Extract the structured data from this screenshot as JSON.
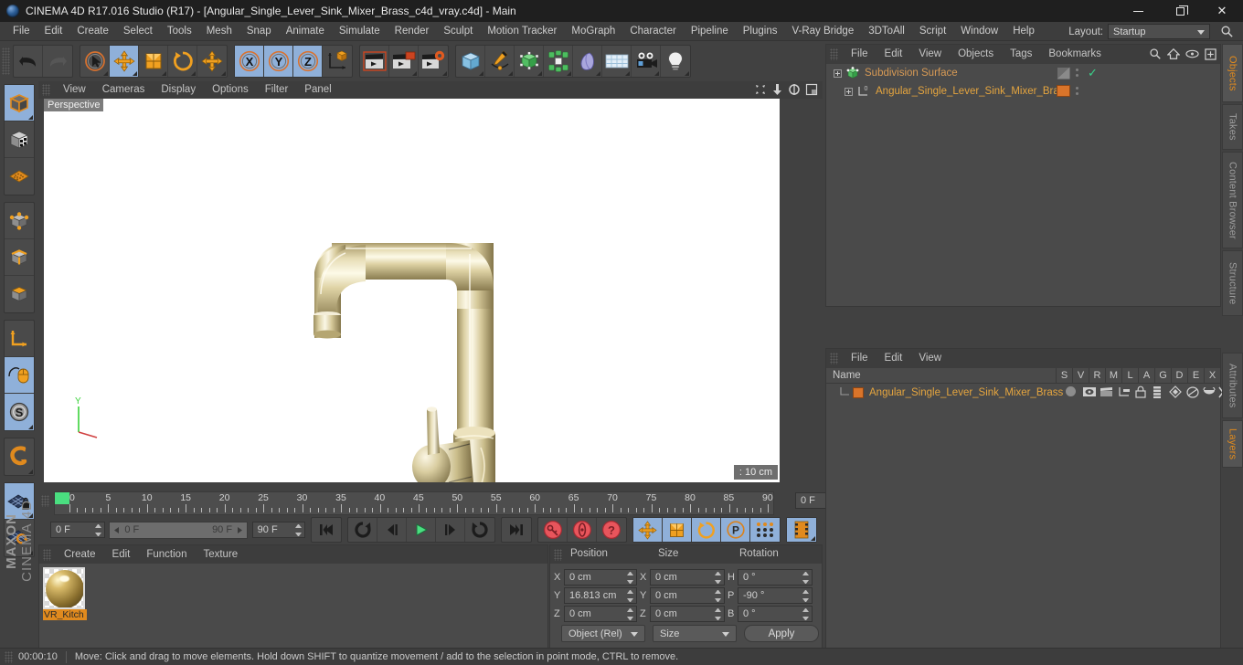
{
  "window": {
    "title": "CINEMA 4D R17.016 Studio (R17) - [Angular_Single_Lever_Sink_Mixer_Brass_c4d_vray.c4d] - Main",
    "minimize": "minimize-icon",
    "maximize": "maximize-icon",
    "close": "close-icon"
  },
  "menubar": {
    "items": [
      "File",
      "Edit",
      "Create",
      "Select",
      "Tools",
      "Mesh",
      "Snap",
      "Animate",
      "Simulate",
      "Render",
      "Sculpt",
      "Motion Tracker",
      "MoGraph",
      "Character",
      "Pipeline",
      "Plugins",
      "V-Ray Bridge",
      "3DToAll",
      "Script",
      "Window",
      "Help"
    ],
    "layout_label": "Layout:",
    "layout_value": "Startup"
  },
  "toolbar": {
    "groups": [
      {
        "name": "history",
        "buttons": [
          {
            "name": "undo-button",
            "icon": "undo-arrow-icon",
            "state": "normal"
          },
          {
            "name": "redo-button",
            "icon": "redo-arrow-icon",
            "state": "disabled"
          }
        ]
      },
      {
        "name": "transform-tools",
        "buttons": [
          {
            "name": "live-selection-tool",
            "icon": "cursor-circle-icon",
            "state": "normal"
          },
          {
            "name": "move-tool",
            "icon": "move-arrows-icon",
            "state": "active"
          },
          {
            "name": "scale-tool",
            "icon": "scale-box-icon",
            "state": "normal"
          },
          {
            "name": "rotate-tool",
            "icon": "rotate-arrow-icon",
            "state": "normal"
          },
          {
            "name": "drag-tool",
            "icon": "move-arrows-icon",
            "state": "normal"
          }
        ]
      },
      {
        "name": "axis-locks",
        "buttons": [
          {
            "name": "x-axis-lock",
            "icon": "x-axis-icon",
            "state": "active"
          },
          {
            "name": "y-axis-lock",
            "icon": "y-axis-icon",
            "state": "active"
          },
          {
            "name": "z-axis-lock",
            "icon": "z-axis-icon",
            "state": "active"
          },
          {
            "name": "world-object-coordinates",
            "icon": "axis-cube-icon",
            "state": "normal"
          }
        ]
      },
      {
        "name": "render-tools",
        "buttons": [
          {
            "name": "render-view-button",
            "icon": "render-clapper-icon",
            "state": "normal"
          },
          {
            "name": "render-to-picture-viewer-button",
            "icon": "render-picture-icon",
            "state": "normal"
          },
          {
            "name": "render-settings-button",
            "icon": "render-gear-icon",
            "state": "normal"
          }
        ]
      },
      {
        "name": "create-objects",
        "buttons": [
          {
            "name": "add-cube-button",
            "icon": "blue-cube-icon",
            "state": "normal"
          },
          {
            "name": "add-spline-button",
            "icon": "pen-spline-icon",
            "state": "normal"
          },
          {
            "name": "add-generator-button",
            "icon": "green-cube-icon",
            "state": "normal"
          },
          {
            "name": "add-deformer-button",
            "icon": "green-explode-icon",
            "state": "normal"
          },
          {
            "name": "add-scene-button",
            "icon": "purple-shape-icon",
            "state": "normal"
          },
          {
            "name": "add-environment-button",
            "icon": "floor-grid-icon",
            "state": "normal"
          },
          {
            "name": "add-camera-button",
            "icon": "camera-icon",
            "state": "normal"
          },
          {
            "name": "add-light-button",
            "icon": "light-bulb-icon",
            "state": "normal"
          }
        ]
      }
    ]
  },
  "left_toolbar": {
    "groups": [
      {
        "buttons": [
          {
            "name": "make-editable-button",
            "icon": "editable-cube-icon",
            "state": "active"
          },
          {
            "name": "model-mode-button",
            "icon": "texture-cube-icon",
            "state": "normal"
          },
          {
            "name": "texture-mode-button",
            "icon": "texture-grid-icon",
            "state": "normal"
          }
        ]
      },
      {
        "buttons": [
          {
            "name": "points-mode-button",
            "icon": "points-cube-icon",
            "state": "normal"
          },
          {
            "name": "edges-mode-button",
            "icon": "edges-cube-icon",
            "state": "normal"
          },
          {
            "name": "polygons-mode-button",
            "icon": "polygon-cube-icon",
            "state": "normal"
          }
        ]
      },
      {
        "buttons": [
          {
            "name": "object-axis-button",
            "icon": "axis-arrows-icon",
            "state": "normal"
          },
          {
            "name": "viewport-interaction-button",
            "icon": "mouse-icon",
            "state": "active"
          },
          {
            "name": "soft-selection-button",
            "icon": "s-circle-icon",
            "state": "active"
          }
        ]
      },
      {
        "buttons": [
          {
            "name": "magnet-tool-button",
            "icon": "magnet-icon",
            "state": "normal"
          }
        ]
      },
      {
        "buttons": [
          {
            "name": "lock-workplane-button",
            "icon": "grid-lock-icon",
            "state": "active"
          },
          {
            "name": "workplane-rotate-button",
            "icon": "grid-rotate-icon",
            "state": "normal"
          }
        ]
      }
    ],
    "brand_line1": "MAXON",
    "brand_line2": "CINEMA 4D"
  },
  "viewport": {
    "menu": [
      "View",
      "Cameras",
      "Display",
      "Options",
      "Filter",
      "Panel"
    ],
    "label": "Perspective",
    "scale": ": 10 cm",
    "axis_label": "Y",
    "corner_icons": [
      "pan-icon",
      "zoom-icon",
      "rotate-icon",
      "maximize-view-icon"
    ]
  },
  "timeline": {
    "ticks": [
      "0",
      "5",
      "10",
      "15",
      "20",
      "25",
      "30",
      "35",
      "40",
      "45",
      "50",
      "55",
      "60",
      "65",
      "70",
      "75",
      "80",
      "85",
      "90"
    ],
    "current_frame_right": "0 F",
    "current_frame_left": "0 F",
    "preview_start": "0 F",
    "preview_end": "90 F",
    "project_end": "90 F",
    "transport": [
      {
        "name": "go-to-start-button",
        "icon": "skip-start-icon"
      },
      {
        "name": "play-backwards-loop-button",
        "icon": "loop-back-icon"
      },
      {
        "name": "previous-frame-button",
        "icon": "step-back-icon"
      },
      {
        "name": "play-button",
        "icon": "play-icon"
      },
      {
        "name": "next-frame-button",
        "icon": "step-forward-icon"
      },
      {
        "name": "play-forwards-loop-button",
        "icon": "loop-forward-icon"
      },
      {
        "name": "go-to-end-button",
        "icon": "skip-end-icon"
      }
    ],
    "keyframe_tools": [
      {
        "name": "record-active-objects-button",
        "icon": "red-key-icon"
      },
      {
        "name": "autokeying-button",
        "icon": "red-autokey-icon"
      },
      {
        "name": "keyframe-selection-button",
        "icon": "red-question-icon"
      }
    ],
    "key_axis": [
      {
        "name": "key-position-button",
        "icon": "move-arrows-icon",
        "state": "active"
      },
      {
        "name": "key-scale-button",
        "icon": "scale-box-icon",
        "state": "active"
      },
      {
        "name": "key-rotation-button",
        "icon": "rotate-arrow-icon",
        "state": "active"
      },
      {
        "name": "key-parameter-button",
        "icon": "p-circle-icon",
        "state": "active"
      },
      {
        "name": "point-level-animation-button",
        "icon": "dots-grid-icon",
        "state": "active"
      }
    ],
    "extra_button": {
      "name": "timeline-strip-button",
      "icon": "film-strip-icon",
      "state": "active"
    }
  },
  "material_manager": {
    "menu": [
      "Create",
      "Edit",
      "Function",
      "Texture"
    ],
    "materials": [
      {
        "name": "VR_Kitch",
        "icon": "brass-material-sphere"
      }
    ]
  },
  "coordinates": {
    "columns": [
      "Position",
      "Size",
      "Rotation"
    ],
    "position": {
      "labels": [
        "X",
        "Y",
        "Z"
      ],
      "values": [
        "0 cm",
        "16.813 cm",
        "0 cm"
      ]
    },
    "size": {
      "labels": [
        "X",
        "Y",
        "Z"
      ],
      "values": [
        "0 cm",
        "0 cm",
        "0 cm"
      ]
    },
    "rotation": {
      "labels": [
        "H",
        "P",
        "B"
      ],
      "values": [
        "0 °",
        "-90 °",
        "0 °"
      ]
    },
    "mode_dropdown": "Object (Rel)",
    "size_dropdown": "Size",
    "apply_button": "Apply"
  },
  "object_manager": {
    "menu": [
      "File",
      "Edit",
      "View",
      "Objects",
      "Tags",
      "Bookmarks"
    ],
    "header_icons": [
      "search-icon",
      "home-icon",
      "eye-icon",
      "new-layer-icon"
    ],
    "rows": [
      {
        "name": "Subdivision Surface",
        "indent": 0,
        "color": "#d79a55",
        "tag_icon": "halfgrey-tag",
        "check": "✓"
      },
      {
        "name": "Angular_Single_Lever_Sink_Mixer_Brass",
        "indent": 1,
        "color": "#e5a53f",
        "tag_icon": "orange-material-tag",
        "check": ""
      }
    ]
  },
  "attribute_manager": {
    "menu": [
      "File",
      "Edit",
      "View"
    ],
    "columns": [
      "Name",
      "S",
      "V",
      "R",
      "M",
      "L",
      "A",
      "G",
      "D",
      "E",
      "X"
    ],
    "rows": [
      {
        "name": "Angular_Single_Lever_Sink_Mixer_Brass",
        "color": "#e5a53f"
      }
    ]
  },
  "vertical_tabs": [
    {
      "label": "Objects",
      "active": true
    },
    {
      "label": "Takes",
      "active": false
    },
    {
      "label": "Content Browser",
      "active": false
    },
    {
      "label": "Structure",
      "active": false
    },
    {
      "label": "Attributes",
      "active": false
    },
    {
      "label": "Layers",
      "active": true
    }
  ],
  "statusbar": {
    "time": "00:00:10",
    "message": "Move: Click and drag to move elements. Hold down SHIFT to quantize movement / add to the selection in point mode, CTRL to remove."
  },
  "colors": {
    "accent_orange": "#e08a1e",
    "active_blue": "#8fb0d9",
    "panel_bg": "#4a4a4a",
    "app_bg": "#414141",
    "titlebar_bg": "#1f1f1f"
  }
}
